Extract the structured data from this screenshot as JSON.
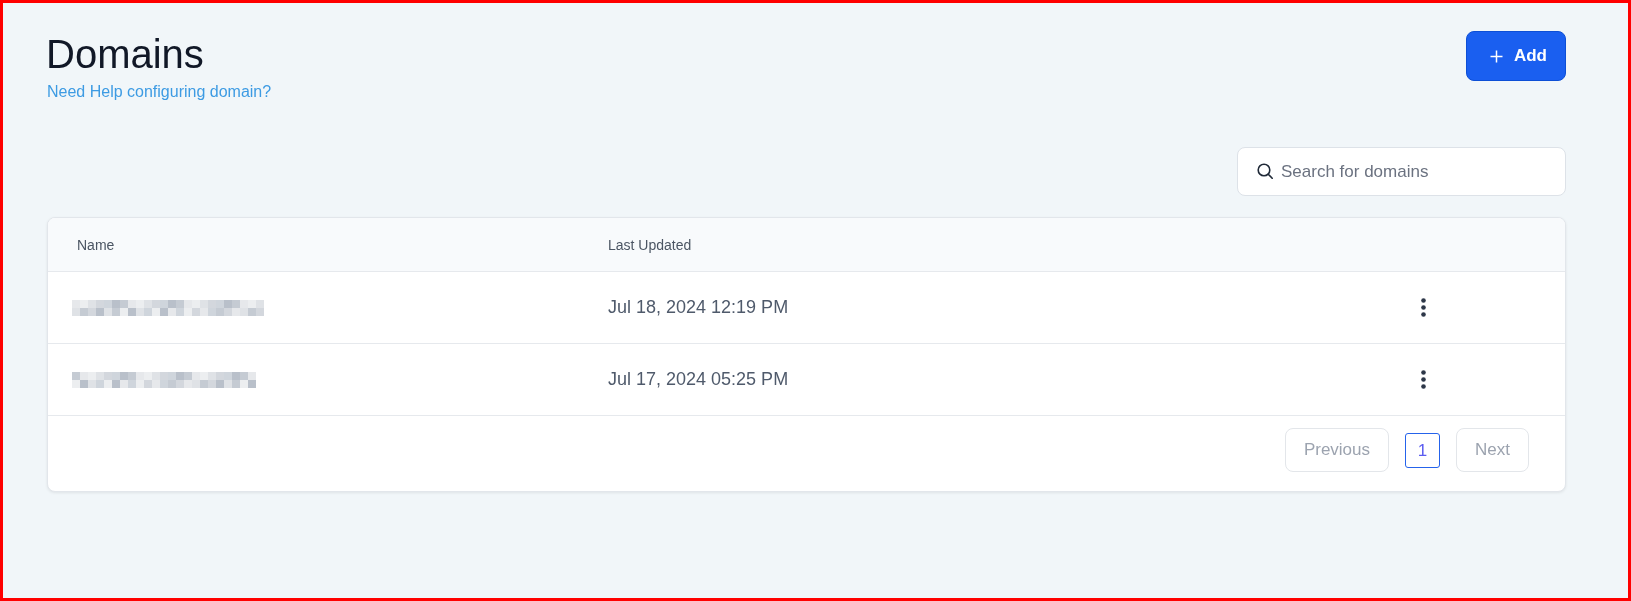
{
  "header": {
    "title": "Domains",
    "help_link": "Need Help configuring domain?",
    "add_button": "Add"
  },
  "search": {
    "placeholder": "Search for domains"
  },
  "table": {
    "columns": [
      "Name",
      "Last Updated"
    ],
    "rows": [
      {
        "last_updated": "Jul 18, 2024 12:19 PM"
      },
      {
        "last_updated": "Jul 17, 2024 05:25 PM"
      }
    ]
  },
  "pagination": {
    "previous": {
      "label": "Previous",
      "disabled": true
    },
    "pages": [
      {
        "label": "1",
        "selected": true
      }
    ],
    "next": {
      "label": "Next",
      "disabled": true
    }
  }
}
